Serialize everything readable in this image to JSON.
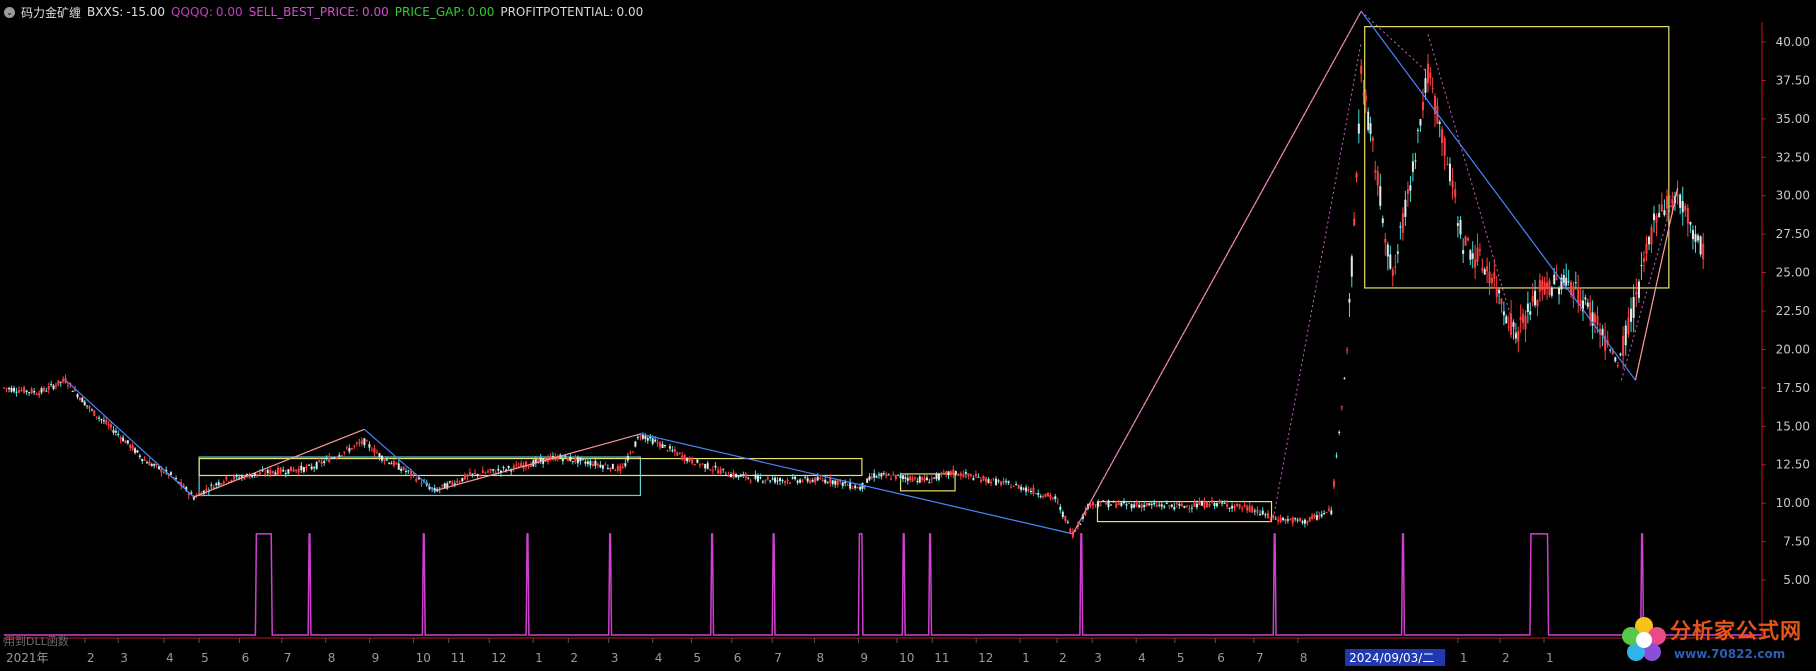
{
  "indicator": {
    "name": "码力金矿缠",
    "items": [
      {
        "label": "BXXS:",
        "value": "-15.00",
        "color": "#e0e0e0"
      },
      {
        "label": "QQQQ:",
        "value": "0.00",
        "color": "#c040c0"
      },
      {
        "label": "SELL_BEST_PRICE:",
        "value": "0.00",
        "color": "#d24fd2"
      },
      {
        "label": "PRICE_GAP:",
        "value": "0.00",
        "color": "#33cc33"
      },
      {
        "label": "PROFITPOTENTIAL:",
        "value": "0.00",
        "color": "#d8d8d8"
      }
    ]
  },
  "footer_note": "用到DLL函数",
  "watermark": {
    "title": "分析家公式网",
    "url": "www.70822.com"
  },
  "colors": {
    "background": "#000000",
    "axis": "#c01818",
    "up": "#ff4040",
    "down": "#40e0e0",
    "signal": "#d040d0",
    "zigzag_up": "#ff9aa0",
    "zigzag_down": "#4a86ff",
    "box_yellow": "#e8e070",
    "box_cyan": "#60d0d0"
  },
  "chart_data": {
    "type": "line",
    "y_ticks": [
      "5.00",
      "7.50",
      "10.00",
      "12.50",
      "15.00",
      "17.50",
      "20.00",
      "22.50",
      "25.00",
      "27.50",
      "30.00",
      "32.50",
      "35.00",
      "37.50",
      "40.00"
    ],
    "ylim": [
      2.5,
      44
    ],
    "x_labels": [
      {
        "text": "2021年",
        "t": 0.0
      },
      {
        "text": "2",
        "t": 0.046
      },
      {
        "text": "3",
        "t": 0.065
      },
      {
        "text": "4",
        "t": 0.091
      },
      {
        "text": "5",
        "t": 0.111
      },
      {
        "text": "6",
        "t": 0.134
      },
      {
        "text": "7",
        "t": 0.158
      },
      {
        "text": "8",
        "t": 0.183
      },
      {
        "text": "9",
        "t": 0.208
      },
      {
        "text": "10",
        "t": 0.233
      },
      {
        "text": "11",
        "t": 0.253
      },
      {
        "text": "12",
        "t": 0.276
      },
      {
        "text": "1",
        "t": 0.301
      },
      {
        "text": "2",
        "t": 0.321
      },
      {
        "text": "3",
        "t": 0.344
      },
      {
        "text": "4",
        "t": 0.369
      },
      {
        "text": "5",
        "t": 0.391
      },
      {
        "text": "6",
        "t": 0.414
      },
      {
        "text": "7",
        "t": 0.437
      },
      {
        "text": "8",
        "t": 0.461
      },
      {
        "text": "9",
        "t": 0.486
      },
      {
        "text": "10",
        "t": 0.508
      },
      {
        "text": "11",
        "t": 0.528
      },
      {
        "text": "12",
        "t": 0.553
      },
      {
        "text": "1",
        "t": 0.578
      },
      {
        "text": "2",
        "t": 0.599
      },
      {
        "text": "3",
        "t": 0.619
      },
      {
        "text": "4",
        "t": 0.644
      },
      {
        "text": "5",
        "t": 0.666
      },
      {
        "text": "6",
        "t": 0.689
      },
      {
        "text": "7",
        "t": 0.711
      },
      {
        "text": "8",
        "t": 0.736
      },
      {
        "text": "1",
        "t": 0.827
      },
      {
        "text": "2",
        "t": 0.851
      },
      {
        "text": "1",
        "t": 0.876
      }
    ],
    "cursor_label": {
      "text": "2024/09/03/二",
      "t": 0.764
    },
    "price_path": [
      [
        0.0,
        17.5
      ],
      [
        0.02,
        17.2
      ],
      [
        0.035,
        18.0
      ],
      [
        0.05,
        16.0
      ],
      [
        0.065,
        14.5
      ],
      [
        0.08,
        12.8
      ],
      [
        0.095,
        11.8
      ],
      [
        0.108,
        10.4
      ],
      [
        0.125,
        11.5
      ],
      [
        0.15,
        12.0
      ],
      [
        0.175,
        12.3
      ],
      [
        0.205,
        14.0
      ],
      [
        0.215,
        13.0
      ],
      [
        0.23,
        12.0
      ],
      [
        0.245,
        10.8
      ],
      [
        0.265,
        11.8
      ],
      [
        0.29,
        12.3
      ],
      [
        0.315,
        13.0
      ],
      [
        0.335,
        12.6
      ],
      [
        0.352,
        12.2
      ],
      [
        0.362,
        14.5
      ],
      [
        0.39,
        12.8
      ],
      [
        0.415,
        11.8
      ],
      [
        0.44,
        11.5
      ],
      [
        0.47,
        11.5
      ],
      [
        0.487,
        11.0
      ],
      [
        0.495,
        11.8
      ],
      [
        0.51,
        11.7
      ],
      [
        0.525,
        11.5
      ],
      [
        0.54,
        12.0
      ],
      [
        0.56,
        11.5
      ],
      [
        0.58,
        11.0
      ],
      [
        0.598,
        10.3
      ],
      [
        0.608,
        8.0
      ],
      [
        0.618,
        10.0
      ],
      [
        0.64,
        9.9
      ],
      [
        0.67,
        9.8
      ],
      [
        0.69,
        10.0
      ],
      [
        0.71,
        9.6
      ],
      [
        0.722,
        9.0
      ],
      [
        0.74,
        8.8
      ],
      [
        0.755,
        9.5
      ],
      [
        0.764,
        20.0
      ],
      [
        0.768,
        28.0
      ],
      [
        0.772,
        38.0
      ],
      [
        0.78,
        32.0
      ],
      [
        0.79,
        24.5
      ],
      [
        0.8,
        31.0
      ],
      [
        0.81,
        38.0
      ],
      [
        0.818,
        34.0
      ],
      [
        0.83,
        27.0
      ],
      [
        0.845,
        25.0
      ],
      [
        0.86,
        21.0
      ],
      [
        0.875,
        24.0
      ],
      [
        0.89,
        24.5
      ],
      [
        0.905,
        22.0
      ],
      [
        0.918,
        19.0
      ],
      [
        0.93,
        24.0
      ],
      [
        0.94,
        29.0
      ],
      [
        0.952,
        30.0
      ],
      [
        0.968,
        26.0
      ]
    ],
    "zigzag": [
      [
        0.035,
        18.0
      ],
      [
        0.108,
        10.4
      ],
      [
        0.205,
        14.8
      ],
      [
        0.245,
        10.8
      ],
      [
        0.362,
        14.5
      ],
      [
        0.608,
        8.0
      ],
      [
        0.772,
        42.0
      ],
      [
        0.928,
        18.0
      ],
      [
        0.952,
        30.5
      ]
    ],
    "boxes": [
      {
        "t0": 0.111,
        "t1": 0.362,
        "y0": 10.5,
        "y1": 13.0,
        "color": "cyan"
      },
      {
        "t0": 0.111,
        "t1": 0.488,
        "y0": 11.8,
        "y1": 12.9,
        "color": "yellow"
      },
      {
        "t0": 0.51,
        "t1": 0.541,
        "y0": 10.8,
        "y1": 11.9,
        "color": "yellow"
      },
      {
        "t0": 0.622,
        "t1": 0.721,
        "y0": 8.8,
        "y1": 10.1,
        "color": "yellow"
      },
      {
        "t0": 0.774,
        "t1": 0.947,
        "y0": 24.0,
        "y1": 41.0,
        "color": "yellow"
      }
    ],
    "signals": [
      {
        "t0": 0.143,
        "t1": 0.152
      },
      {
        "t0": 0.173,
        "t1": 0.174
      },
      {
        "t0": 0.238,
        "t1": 0.239
      },
      {
        "t0": 0.297,
        "t1": 0.298
      },
      {
        "t0": 0.344,
        "t1": 0.345
      },
      {
        "t0": 0.402,
        "t1": 0.403
      },
      {
        "t0": 0.437,
        "t1": 0.438
      },
      {
        "t0": 0.486,
        "t1": 0.488
      },
      {
        "t0": 0.511,
        "t1": 0.512
      },
      {
        "t0": 0.526,
        "t1": 0.527
      },
      {
        "t0": 0.612,
        "t1": 0.613
      },
      {
        "t0": 0.722,
        "t1": 0.723
      },
      {
        "t0": 0.795,
        "t1": 0.796
      },
      {
        "t0": 0.868,
        "t1": 0.878
      },
      {
        "t0": 0.931,
        "t1": 0.932
      }
    ]
  }
}
